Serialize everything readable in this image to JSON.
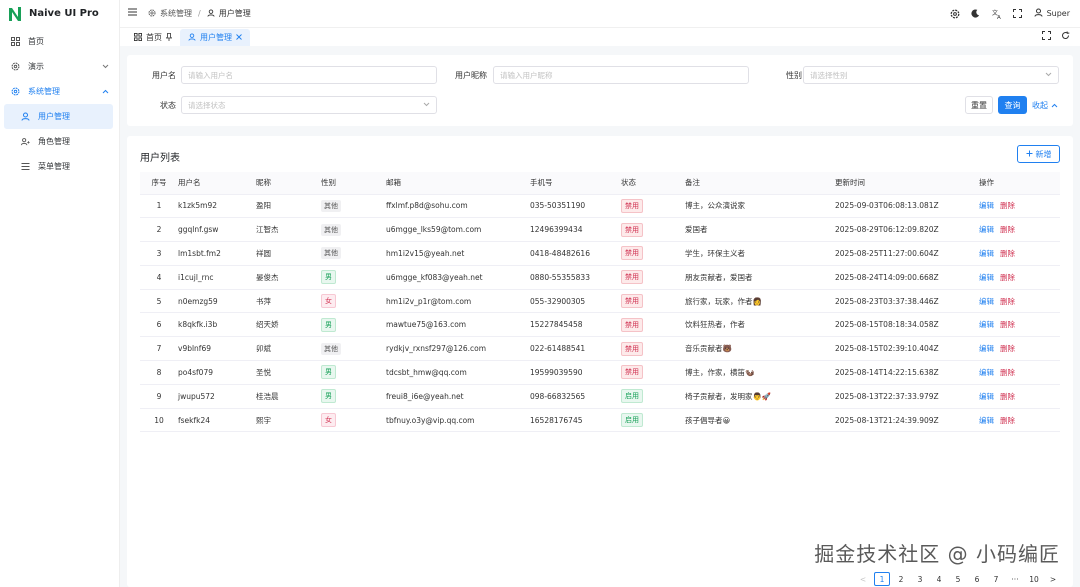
{
  "app": {
    "title": "Naive UI Pro"
  },
  "sidebar": {
    "items": [
      {
        "label": "首页",
        "icon": "dashboard-icon"
      },
      {
        "label": "演示",
        "icon": "gear-icon",
        "chevron": "⌄"
      },
      {
        "label": "系统管理",
        "icon": "gear-icon",
        "chevron": "⌃"
      }
    ],
    "sub_items": [
      {
        "label": "用户管理",
        "icon": "user-icon"
      },
      {
        "label": "角色管理",
        "icon": "users-icon"
      },
      {
        "label": "菜单管理",
        "icon": "menu-list-icon"
      }
    ]
  },
  "header": {
    "breadcrumb": [
      "系统管理",
      "用户管理"
    ],
    "user": "Super"
  },
  "tabs": [
    {
      "label": "首页"
    },
    {
      "label": "用户管理"
    }
  ],
  "search": {
    "username_label": "用户名",
    "username_placeholder": "请输入用户名",
    "nickname_label": "用户昵称",
    "nickname_placeholder": "请输入用户昵称",
    "gender_label": "性别",
    "gender_placeholder": "请选择性别",
    "status_label": "状态",
    "status_placeholder": "请选择状态",
    "reset_label": "重置",
    "query_label": "查询",
    "collapse_label": "收起"
  },
  "table": {
    "title": "用户列表",
    "add_label": "新增",
    "columns": [
      "序号",
      "用户名",
      "昵称",
      "性别",
      "邮箱",
      "手机号",
      "状态",
      "备注",
      "更新时间",
      "操作"
    ],
    "edit_label": "编辑",
    "delete_label": "删除",
    "rows": [
      {
        "no": "1",
        "username": "k1zk5m92",
        "nickname": "盈阳",
        "gender": "其他",
        "email": "ffxlmf.p8d@sohu.com",
        "phone": "035-50351190",
        "status": "禁用",
        "remark": "博主，公众演说家",
        "updated": "2025-09-03T06:08:13.081Z"
      },
      {
        "no": "2",
        "username": "ggqlnf.gsw",
        "nickname": "江智杰",
        "gender": "其他",
        "email": "u6mgge_lks59@tom.com",
        "phone": "12496399434",
        "status": "禁用",
        "remark": "爱国者",
        "updated": "2025-08-29T06:12:09.820Z"
      },
      {
        "no": "3",
        "username": "lm1sbt.fm2",
        "nickname": "祥圆",
        "gender": "其他",
        "email": "hm1i2v15@yeah.net",
        "phone": "0418-48482616",
        "status": "禁用",
        "remark": "学生，环保主义者",
        "updated": "2025-08-25T11:27:00.604Z"
      },
      {
        "no": "4",
        "username": "i1cujl_rnc",
        "nickname": "晏俊杰",
        "gender": "男",
        "email": "u6mgge_kf083@yeah.net",
        "phone": "0880-55355833",
        "status": "禁用",
        "remark": "朋友贡献者，爱国者",
        "updated": "2025-08-24T14:09:00.668Z"
      },
      {
        "no": "5",
        "username": "n0emzg59",
        "nickname": "书萍",
        "gender": "女",
        "email": "hm1i2v_p1r@tom.com",
        "phone": "055-32900305",
        "status": "禁用",
        "remark": "旅行家，玩家，作者👩",
        "updated": "2025-08-23T03:37:38.446Z"
      },
      {
        "no": "6",
        "username": "k8qkfk.i3b",
        "nickname": "绍天娇",
        "gender": "男",
        "email": "mawtue75@163.com",
        "phone": "15227845458",
        "status": "禁用",
        "remark": "饮料狂热者，作者",
        "updated": "2025-08-15T08:18:34.058Z"
      },
      {
        "no": "7",
        "username": "v9blnf69",
        "nickname": "卯斌",
        "gender": "其他",
        "email": "rydkjv_rxnsf297@126.com",
        "phone": "022-61488541",
        "status": "禁用",
        "remark": "音乐贡献者🐻",
        "updated": "2025-08-15T02:39:10.404Z"
      },
      {
        "no": "8",
        "username": "po4sf079",
        "nickname": "圣悦",
        "gender": "男",
        "email": "tdcsbt_hmw@qq.com",
        "phone": "19599039590",
        "status": "禁用",
        "remark": "博主，作家，横笛🦦",
        "updated": "2025-08-14T14:22:15.638Z"
      },
      {
        "no": "9",
        "username": "jwupu572",
        "nickname": "桂浩晨",
        "gender": "男",
        "email": "freui8_i6e@yeah.net",
        "phone": "098-66832565",
        "status": "启用",
        "remark": "椅子贡献者，发明家👨🚀",
        "updated": "2025-08-13T22:37:33.979Z"
      },
      {
        "no": "10",
        "username": "fsekfk24",
        "nickname": "熙宇",
        "gender": "女",
        "email": "tbfnuy.o3y@vip.qq.com",
        "phone": "16528176745",
        "status": "启用",
        "remark": "孩子倡导者😀",
        "updated": "2025-08-13T21:24:39.909Z"
      }
    ]
  },
  "pagination": {
    "prev": "<",
    "pages": [
      "1",
      "2",
      "3",
      "4",
      "5",
      "6",
      "7",
      "···",
      "10"
    ],
    "next": ">",
    "current": "1"
  },
  "watermark": "掘金技术社区 @ 小码编匠",
  "colors": {
    "primary": "#2080f0",
    "danger": "#d03050",
    "success": "#18a058",
    "logo": "#18a058"
  }
}
